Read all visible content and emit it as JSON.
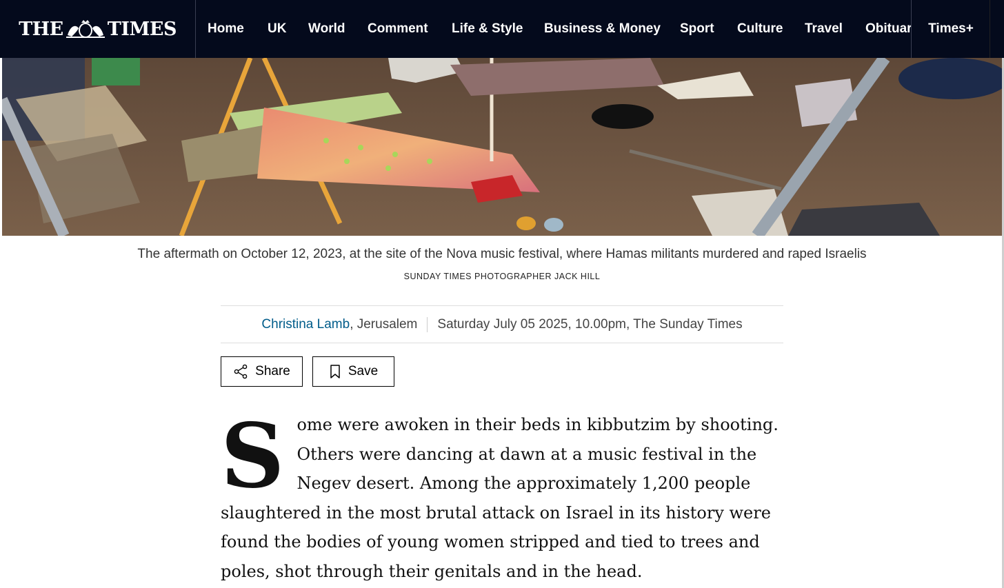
{
  "brand": {
    "logo_left": "THE",
    "logo_right": "TIMES"
  },
  "nav": {
    "items": [
      "Home",
      "UK",
      "World",
      "Comment",
      "Life & Style",
      "Business & Money",
      "Sport",
      "Culture",
      "Travel",
      "Obituar"
    ],
    "times_plus": "Times+"
  },
  "photo": {
    "caption": "The aftermath on October 12, 2023, at the site of the Nova music festival, where Hamas militants murdered and raped Israelis",
    "credit": "SUNDAY TIMES PHOTOGRAPHER JACK HILL"
  },
  "byline": {
    "author": "Christina Lamb",
    "location": ", Jerusalem",
    "date": "Saturday July 05 2025, 10.00pm, The Sunday Times"
  },
  "actions": {
    "share": "Share",
    "save": "Save"
  },
  "article": {
    "drop_cap": "S",
    "first_paragraph": "ome were awoken in their beds in kibbutzim by shooting. Others were dancing at dawn at a music festival in the Negev desert. Among the approximately 1,200 people slaughtered in the most brutal attack on Israel in its history were found the bodies of young women stripped and tied to trees and poles, shot through their genitals and in the head."
  },
  "colors": {
    "nav_bg": "#040a1c",
    "author_link": "#005c8a"
  }
}
